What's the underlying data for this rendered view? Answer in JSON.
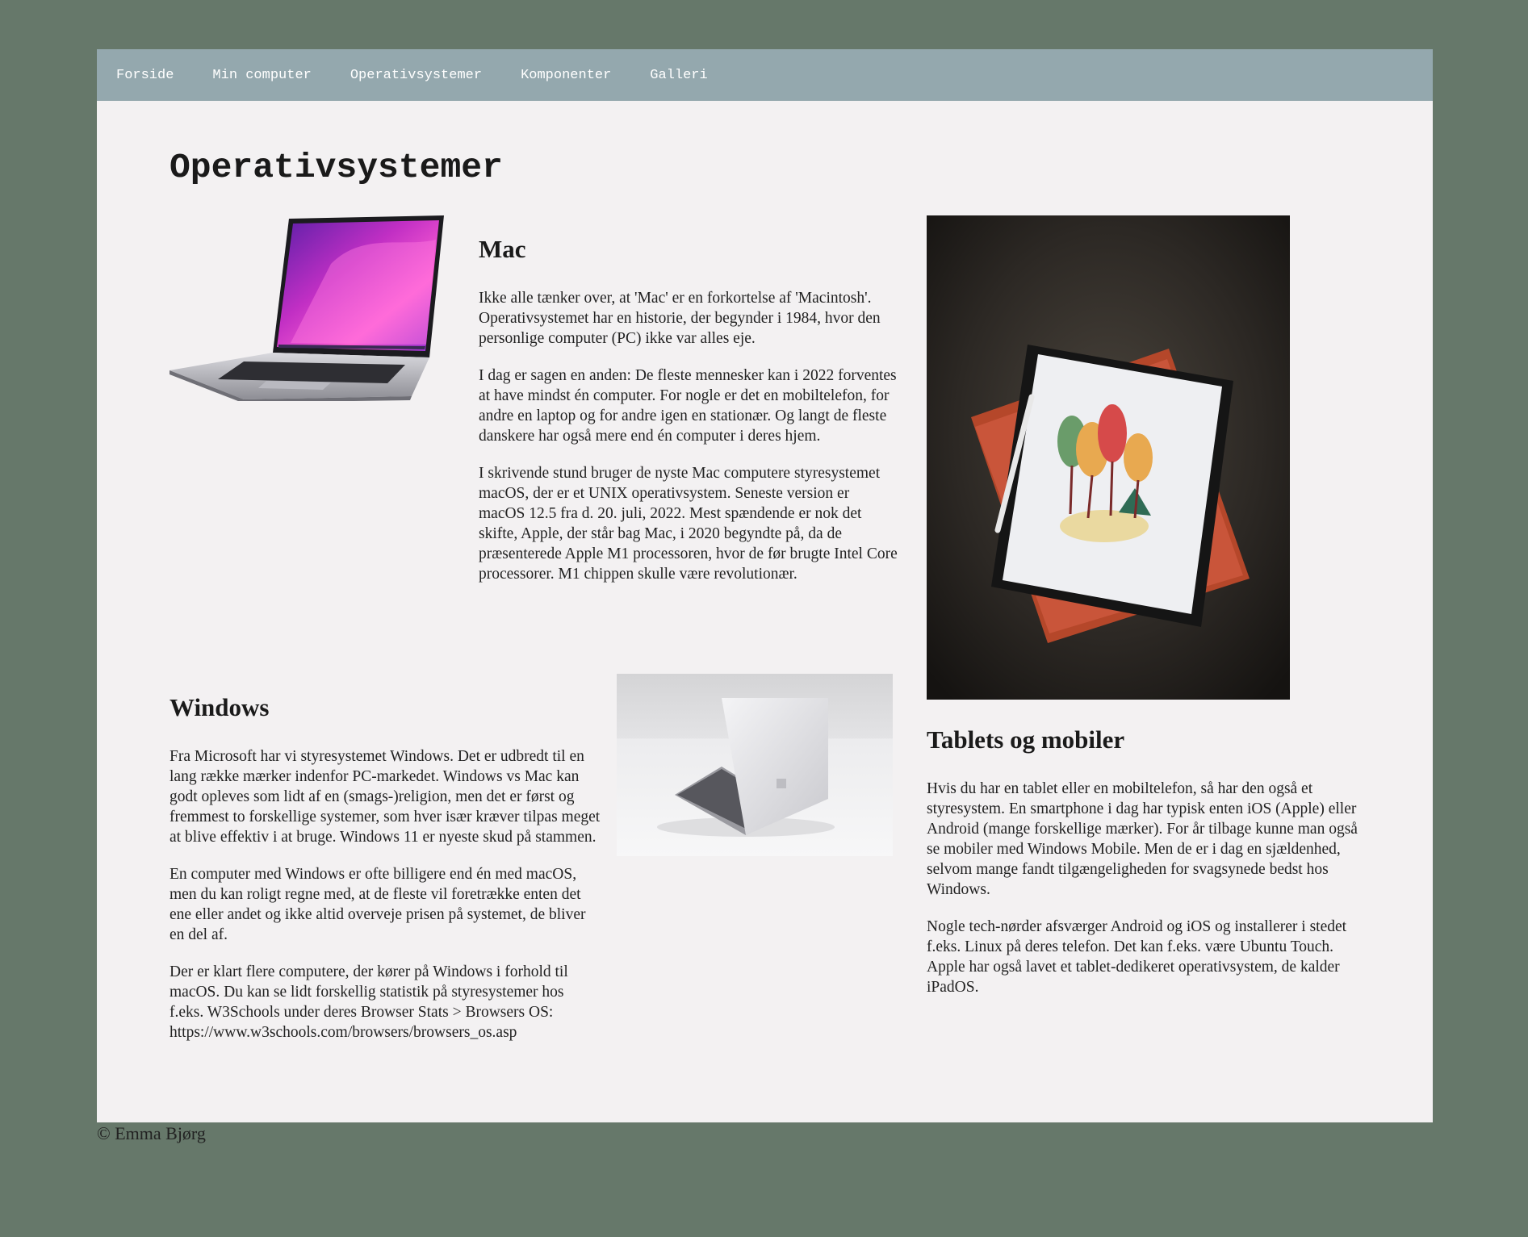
{
  "nav": {
    "items": [
      "Forside",
      "Min computer",
      "Operativsystemer",
      "Komponenter",
      "Galleri"
    ]
  },
  "page_title": "Operativsystemer",
  "mac": {
    "heading": "Mac",
    "paragraphs": [
      "Ikke alle tænker over, at 'Mac' er en forkortelse af 'Macintosh'. Operativsystemet har en historie, der begynder i 1984, hvor den personlige computer (PC) ikke var alles eje.",
      "I dag er sagen en anden: De fleste mennesker kan i 2022 forventes at have mindst én computer. For nogle er det en mobiltelefon, for andre en laptop og for andre igen en stationær. Og langt de fleste danskere har også mere end én computer i deres hjem.",
      "I skrivende stund bruger de nyste Mac computere styresystemet macOS, der er et UNIX operativsystem. Seneste version er macOS 12.5 fra d. 20. juli, 2022. Mest spændende er nok det skifte, Apple, der står bag Mac, i 2020 begyndte på, da de præsenterede Apple M1 processoren, hvor de før brugte Intel Core processorer. M1 chippen skulle være revolutionær."
    ]
  },
  "windows": {
    "heading": "Windows",
    "paragraphs": [
      "Fra Microsoft har vi styresystemet Windows. Det er udbredt til en lang række mærker indenfor PC-markedet. Windows vs Mac kan godt opleves som lidt af en (smags-)religion, men det er først og fremmest to forskellige systemer, som hver især kræver tilpas meget at blive effektiv i at bruge. Windows 11 er nyeste skud på stammen.",
      "En computer med Windows er ofte billigere end én med macOS, men du kan roligt regne med, at de fleste vil foretrække enten det ene eller andet og ikke altid overveje prisen på systemet, de bliver en del af.",
      "Der er klart flere computere, der kører på Windows i forhold til macOS. Du kan se lidt forskellig statistik på styresystemer hos f.eks. W3Schools under deres Browser Stats > Browsers OS: https://www.w3schools.com/browsers/browsers_os.asp"
    ]
  },
  "tablets": {
    "heading": "Tablets og mobiler",
    "paragraphs": [
      "Hvis du har en tablet eller en mobiltelefon, så har den også et styresystem. En smartphone i dag har typisk enten iOS (Apple) eller Android (mange forskellige mærker). For år tilbage kunne man også se mobiler med Windows Mobile. Men de er i dag en sjældenhed, selvom mange fandt tilgængeligheden for svagsynede bedst hos Windows.",
      "Nogle tech-nørder afsværger Android og iOS og installerer i stedet f.eks. Linux på deres telefon. Det kan f.eks. være Ubuntu Touch. Apple har også lavet et tablet-dedikeret operativsystem, de kalder iPadOS."
    ]
  },
  "footer": "© Emma Bjørg"
}
